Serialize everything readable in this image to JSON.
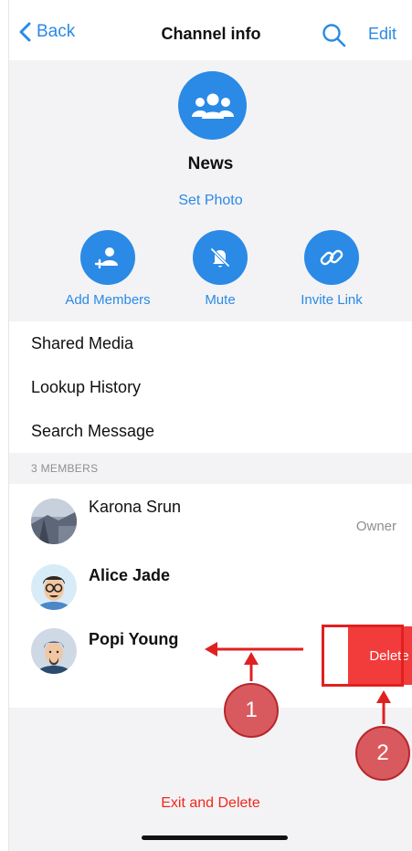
{
  "nav": {
    "back_label": "Back",
    "title": "Channel info",
    "edit_label": "Edit"
  },
  "channel": {
    "name": "News",
    "set_photo": "Set Photo"
  },
  "actions": [
    {
      "label": "Add Members",
      "icon": "add-member-icon"
    },
    {
      "label": "Mute",
      "icon": "bell-slash-icon"
    },
    {
      "label": "Invite Link",
      "icon": "link-icon"
    }
  ],
  "menu": [
    "Shared Media",
    "Lookup History",
    "Search Message"
  ],
  "members_header": "3 MEMBERS",
  "members": [
    {
      "name": "Karona Srun",
      "role": "Owner"
    },
    {
      "name": "Alice Jade",
      "role": ""
    },
    {
      "name": "Popi Young",
      "role": ""
    }
  ],
  "delete_label": "Delete",
  "exit_label": "Exit and Delete",
  "annotations": {
    "step1": "1",
    "step2": "2"
  },
  "colors": {
    "accent": "#2a8ae6",
    "danger": "#f23b3b",
    "annotation": "#e02020"
  }
}
